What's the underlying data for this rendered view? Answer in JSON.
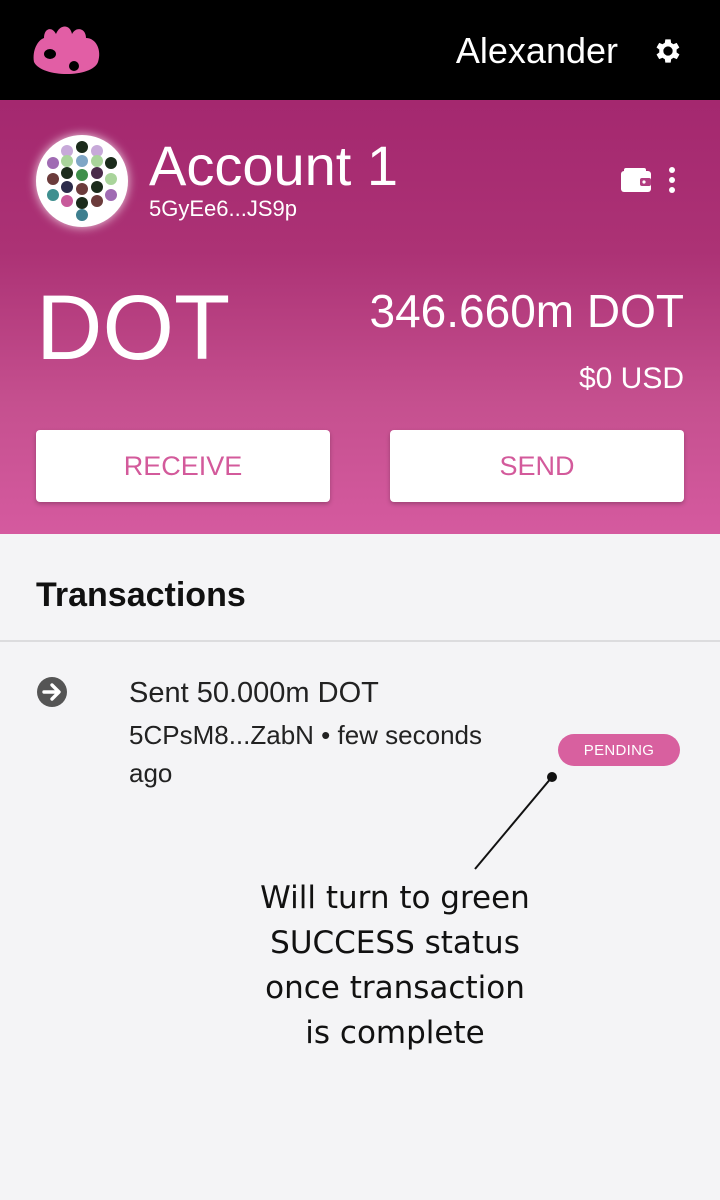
{
  "header": {
    "username": "Alexander",
    "logo_icon": "app-logo-icon",
    "settings_icon": "gear-icon"
  },
  "account": {
    "name": "Account 1",
    "address": "5GyEe6...JS9p",
    "wallet_icon": "wallet-icon",
    "more_icon": "more-vertical-icon"
  },
  "balance": {
    "token": "DOT",
    "amount": "346.660m DOT",
    "fiat": "$0 USD"
  },
  "actions": {
    "receive_label": "RECEIVE",
    "send_label": "SEND"
  },
  "transactions": {
    "heading": "Transactions",
    "items": [
      {
        "icon": "arrow-right-circle-icon",
        "title": "Sent 50.000m DOT",
        "subtitle": "5CPsM8...ZabN • few seconds ago",
        "status": "PENDING"
      }
    ]
  },
  "annotation": {
    "lines": [
      "Will turn to green",
      "SUCCESS status",
      "once transaction",
      "is complete"
    ]
  },
  "colors": {
    "topbar": "#000000",
    "hero_top": "#a4286f",
    "hero_bottom": "#d55a9f",
    "accent": "#d35a9b",
    "pending_badge": "#d8609f",
    "background": "#f4f4f6"
  }
}
